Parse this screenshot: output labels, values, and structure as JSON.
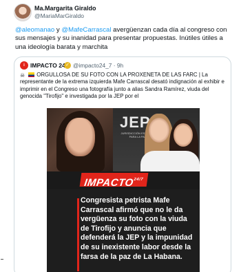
{
  "author": {
    "name": "Ma.Margarita Giraldo",
    "handle": "@MariaMarGiraldo"
  },
  "tweet": {
    "mention_1": "@aleomanao",
    "connector": " y ",
    "mention_2": "@MafeCarrascal",
    "text": " avergüenzan cada día al congreso con sus mensajes y su inanidad para presentar propuestas. Inútiles útiles a una ideología barata y marchita"
  },
  "quote": {
    "logo_text": "i",
    "name": "IMPACTO 24/7",
    "handle": "@impacto24_7 · 9h",
    "text": "ORGULLOSA DE SU FOTO CON LA PROXENETA DE LAS FARC | La representante de la extrema izquierda Mafe Carrascal desató indignación al exhibir e imprimir en el Congreso una fotografía junto a alias Sandra Ramírez, viuda del genocida \"Tirofijo\" e investigada por la JEP por el"
  },
  "media": {
    "sign_text": "JEP",
    "sign_subtext": "JURISDICCIÓN ESPECIAL PARA LA PAZ",
    "brand": "IMPACTO",
    "brand_sup": "24/7",
    "caption": "Congresista petrista Mafe Carrascal afirmó que no le da vergüenza su foto con la viuda de Tirofijo y anuncia que defenderá la JEP y la impunidad de su inexistente labor desde la farsa de la paz de La Habana."
  },
  "colors": {
    "link": "#1d9bf0",
    "brand_red": "#e1251b",
    "verified_gold": "#e8b923"
  }
}
